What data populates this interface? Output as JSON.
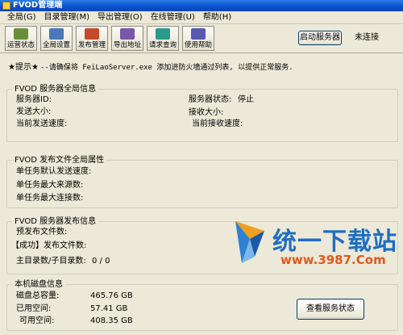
{
  "window": {
    "title": "FVOD管理端"
  },
  "menu": [
    "全局(G)",
    "目录管理(M)",
    "导出管理(O)",
    "在线管理(U)",
    "帮助(H)"
  ],
  "toolbar": [
    {
      "label": "运营状态",
      "icon": "status-icon",
      "color": "#6a8f3c"
    },
    {
      "label": "全局设置",
      "icon": "settings-icon",
      "color": "#4a78b8"
    },
    {
      "label": "发布管理",
      "icon": "publish-icon",
      "color": "#c44a2a"
    },
    {
      "label": "导出地址",
      "icon": "export-icon",
      "color": "#7a58a8"
    },
    {
      "label": "请求查询",
      "icon": "query-icon",
      "color": "#2a9a8a"
    },
    {
      "label": "使用帮助",
      "icon": "help-icon",
      "color": "#5a5ab0"
    }
  ],
  "server": {
    "start_button": "启动服务器",
    "connection_status": "未连接"
  },
  "tip": {
    "prefix": "★提示★",
    "text": "--请确保将 FeiLaoServer.exe 添加进防火墙通过列表, 以提供正常服务."
  },
  "server_info": {
    "title": "FVOD 服务器全局信息",
    "server_id_label": "服务器ID:",
    "server_status_label": "服务器状态:",
    "server_status_value": "停止",
    "send_size_label": "发送大小:",
    "recv_size_label": "接收大小:",
    "send_speed_label": "当前发送速度:",
    "recv_speed_label": "当前接收速度:"
  },
  "publish_props": {
    "title": "FVOD 发布文件全局属性",
    "default_speed_label": "单任务默认发送速度:",
    "max_sources_label": "单任务最大来源数:",
    "max_connections_label": "单任务最大连接数:"
  },
  "publish_info": {
    "title": "FVOD 服务器发布信息",
    "pending_label": "预发布文件数:",
    "success_label": "【成功】发布文件数:",
    "dirs_label": "主目录数/子目录数:",
    "dirs_value": "0 / 0"
  },
  "disk": {
    "title": "本机磁盘信息",
    "total_label": "磁盘总容量:",
    "total_value": "465.76 GB",
    "used_label": "已用空间:",
    "used_value": "57.41 GB",
    "free_label": "可用空间:",
    "free_value": "408.35 GB",
    "view_button": "查看服务状态"
  },
  "watermark": {
    "name": "统一下载站",
    "url": "www.3987.Com"
  }
}
